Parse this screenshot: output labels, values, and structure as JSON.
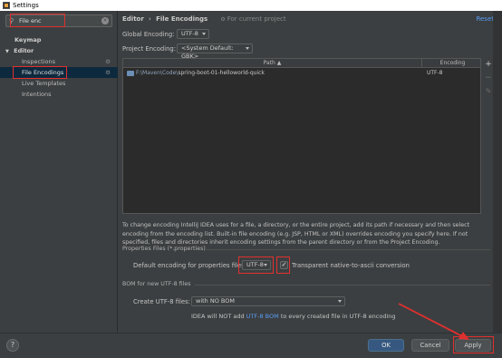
{
  "window": {
    "title": "Settings"
  },
  "search": {
    "value": "File enc",
    "placeholder": ""
  },
  "sidebar": {
    "items": [
      {
        "label": "Keymap",
        "bold": true
      },
      {
        "label": "Editor",
        "bold": true,
        "expander": "▼"
      },
      {
        "label": "Inspections"
      },
      {
        "label": "File Encodings",
        "selected": true
      },
      {
        "label": "Live Templates"
      },
      {
        "label": "Intentions"
      }
    ]
  },
  "header": {
    "breadcrumb_parent": "Editor",
    "breadcrumb_sep": "›",
    "breadcrumb_current": "File Encodings",
    "scope_note": "For current project",
    "reset_label": "Reset"
  },
  "encoding": {
    "global_label": "Global Encoding:",
    "global_value": "UTF-8",
    "project_label": "Project Encoding:",
    "project_value": "<System Default: GBK>"
  },
  "table": {
    "columns": [
      "Path ▲",
      "Encoding"
    ],
    "rows": [
      {
        "path_prefix": "F:\\Maven\\Code\\",
        "path_last": "spring-boot-01-helloworld-quick",
        "encoding": "UTF-8"
      }
    ],
    "tools": {
      "add": "+",
      "remove": "−",
      "edit": "✎"
    }
  },
  "description": "To change encoding IntelliJ IDEA uses for a file, a directory, or the entire project, add its path if necessary and then select encoding from the encoding list. Built-in file encoding (e.g. JSP, HTML or XML) overrides encoding you specify here. If not specified, files and directories inherit encoding settings from the parent directory or from the Project Encoding.",
  "properties": {
    "section_title": "Properties Files (*.properties)",
    "default_label": "Default encoding for properties files:",
    "default_value": "UTF-8",
    "transparent_label": "Transparent native-to-ascii conversion",
    "transparent_checked": true
  },
  "bom": {
    "section_title": "BOM for new UTF-8 files",
    "create_label": "Create UTF-8 files:",
    "create_value": "with NO BOM",
    "note_prefix": "IDEA will NOT add ",
    "note_link": "UTF-8 BOM",
    "note_suffix": " to every created file in UTF-8 encoding"
  },
  "footer": {
    "help": "?",
    "ok_label": "OK",
    "cancel_label": "Cancel",
    "apply_label": "Apply"
  },
  "colors": {
    "background": "#3c3f41",
    "selection": "#0d293e",
    "accent_blue": "#589df6",
    "annotation_red": "#e0302f",
    "ok_button": "#365880"
  }
}
